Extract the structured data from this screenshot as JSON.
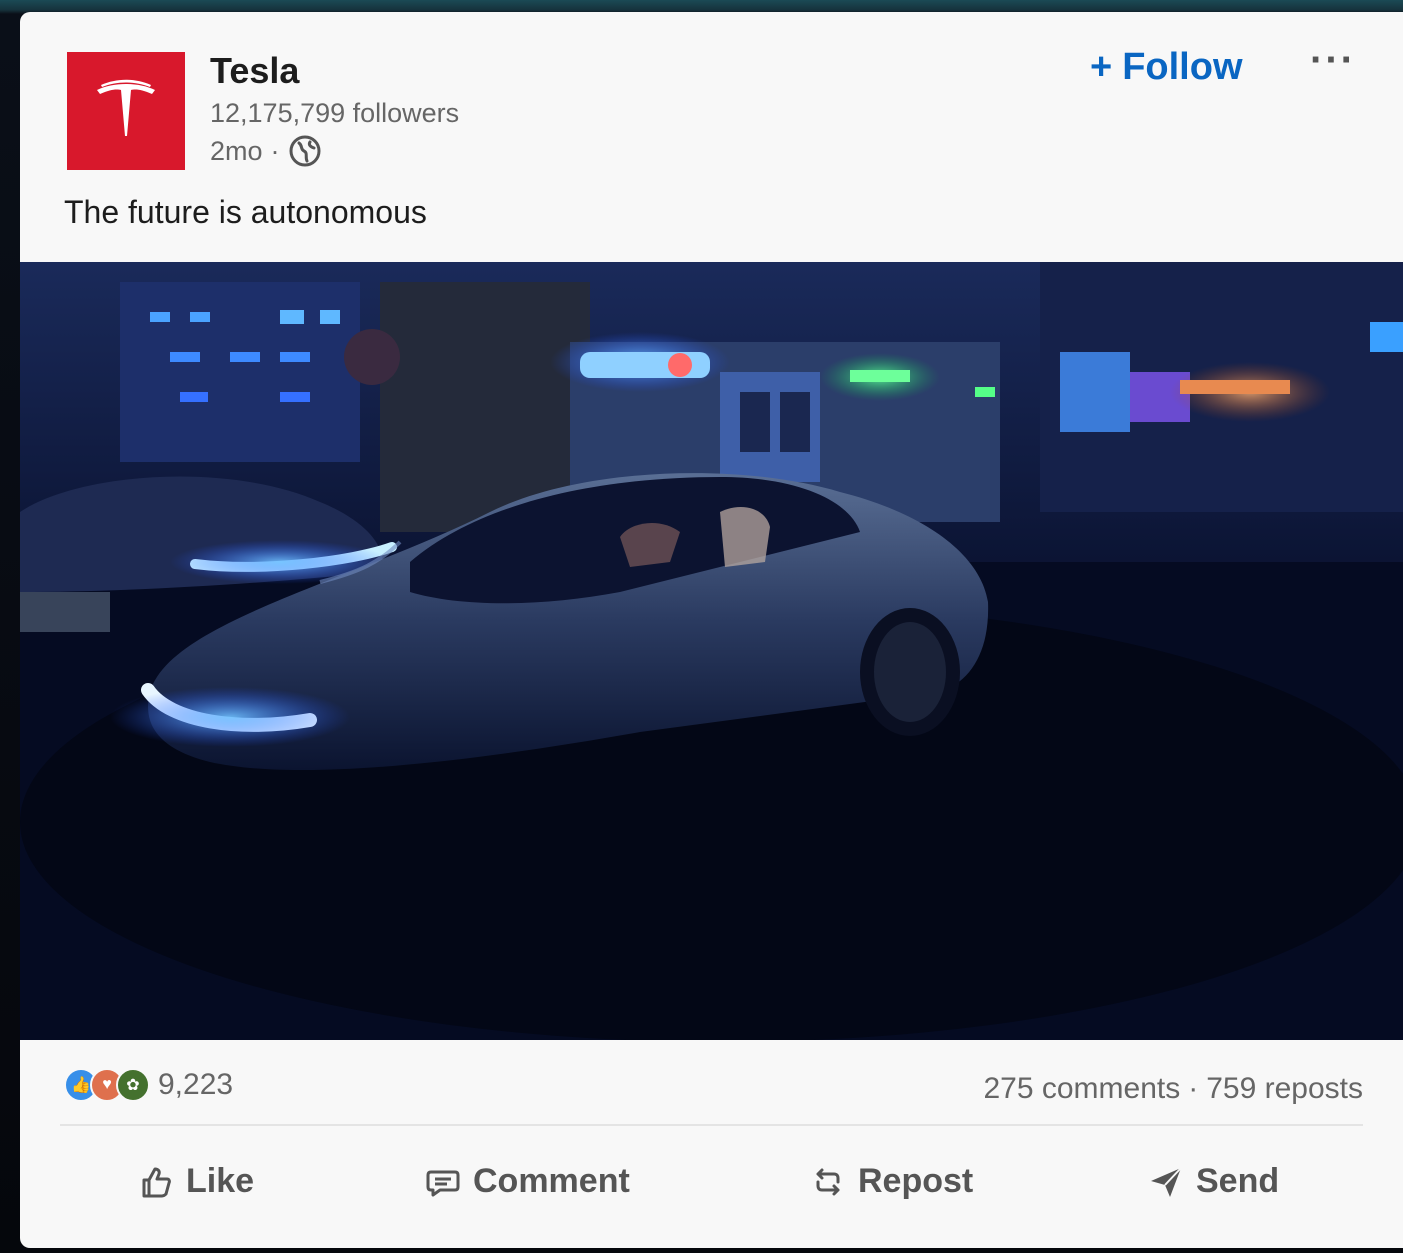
{
  "post": {
    "author": {
      "name": "Tesla",
      "followers": "12,175,799 followers",
      "age": "2mo",
      "separator": "·"
    },
    "follow_label": "Follow",
    "follow_plus": "+",
    "more_label": "···",
    "caption": "The future is autonomous",
    "media_icon": "video-still-car-at-night"
  },
  "stats": {
    "reaction_icons": [
      "like-icon",
      "love-icon",
      "support-icon"
    ],
    "reactions_count": "9,223",
    "comments": "275 comments",
    "dot": "·",
    "reposts": "759 reposts"
  },
  "actions": {
    "like": "Like",
    "comment": "Comment",
    "repost": "Repost",
    "send": "Send"
  },
  "colors": {
    "brand_red": "#d8182c",
    "linkedin_blue": "#0a66c2"
  }
}
